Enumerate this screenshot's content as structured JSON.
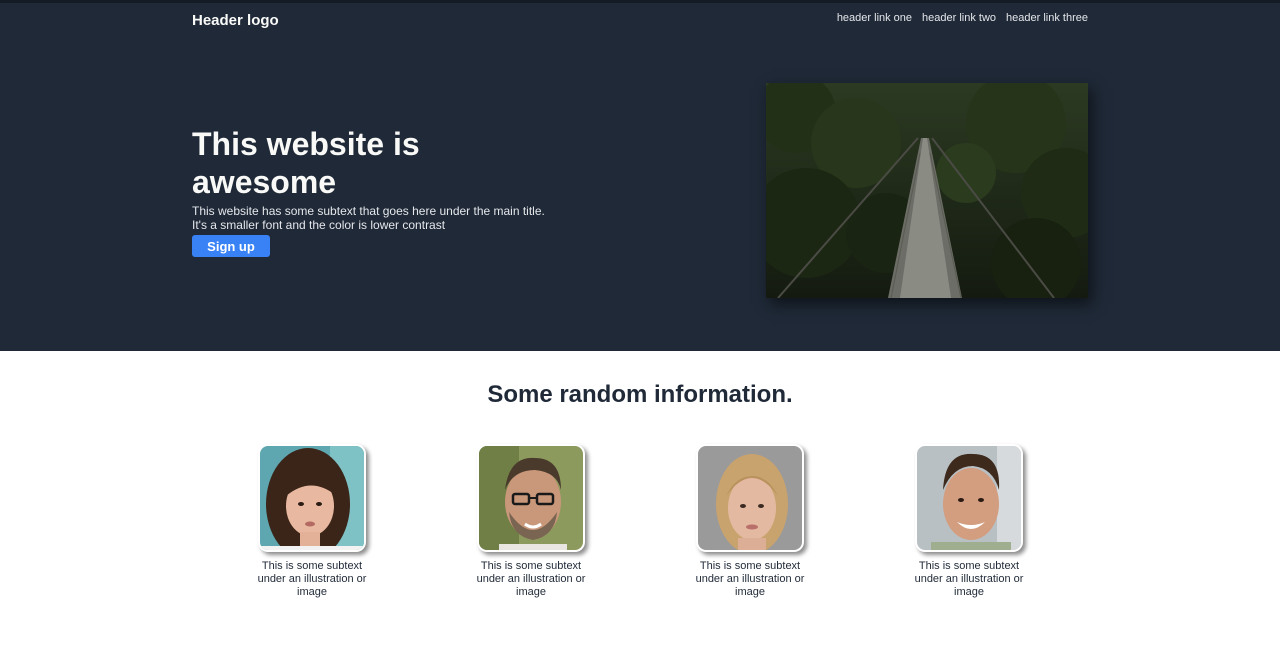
{
  "header": {
    "logo": "Header logo",
    "links": [
      "header link one",
      "header link two",
      "header link three"
    ]
  },
  "hero": {
    "title": "This website is awesome",
    "subtext": "This website has some subtext that goes here under the main title. It's a smaller font and the color is lower contrast",
    "button": "Sign up",
    "image_icon": "suspension-bridge-forest-photo"
  },
  "info": {
    "title": "Some random information.",
    "cards": [
      {
        "text": "This is some subtext under an illustration or image",
        "icon": "portrait-woman-1"
      },
      {
        "text": "This is some subtext under an illustration or image",
        "icon": "portrait-man-glasses"
      },
      {
        "text": "This is some subtext under an illustration or image",
        "icon": "portrait-woman-2"
      },
      {
        "text": "This is some subtext under an illustration or image",
        "icon": "portrait-man-smiling"
      }
    ]
  },
  "colors": {
    "hero_bg": "#1f2937",
    "accent": "#3882f6",
    "light_text": "#f9faf8"
  }
}
